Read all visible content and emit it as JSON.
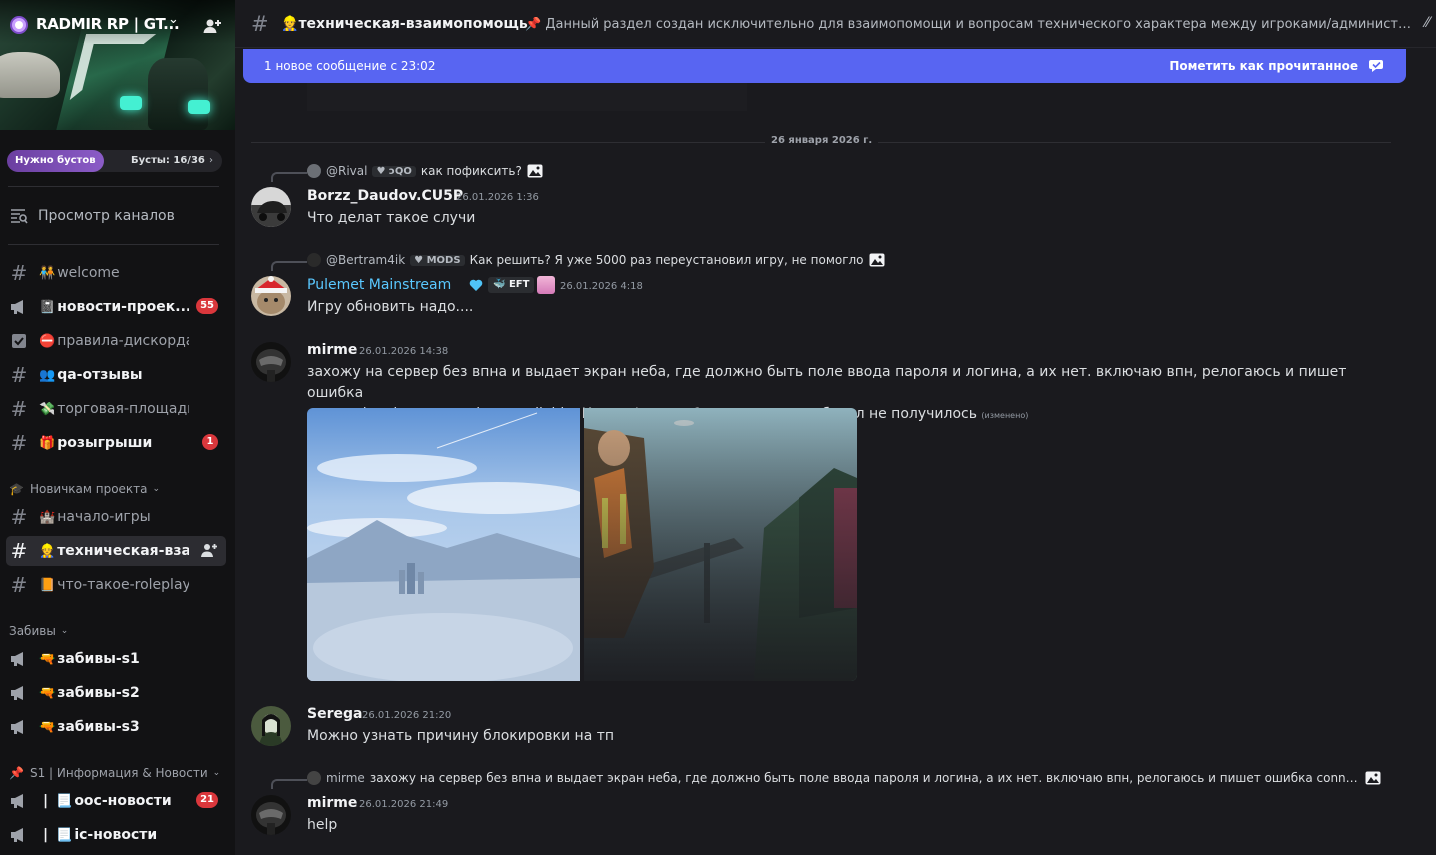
{
  "server": {
    "name": "RADMIR RP | GT...",
    "boost_label": "Нужно бустов",
    "boost_count": "Бусты: 16/36"
  },
  "sidebar": {
    "browse_label": "Просмотр каналов",
    "channels_top": [
      {
        "emoji": "🧑‍🤝‍🧑",
        "label": "welcome",
        "type": "text"
      },
      {
        "emoji": "📓",
        "label": "новости-проек...",
        "type": "announce",
        "badge": "55"
      },
      {
        "emoji": "⛔",
        "label": "правила-дискорда",
        "type": "rules"
      },
      {
        "emoji": "👥",
        "label": "qa-отзывы",
        "type": "text"
      },
      {
        "emoji": "💸",
        "label": "торговая-площадка",
        "type": "text"
      },
      {
        "emoji": "🎁",
        "label": "розыгрыши",
        "type": "text",
        "badge": "1"
      }
    ],
    "category_newbie": "Новичкам проекта",
    "channels_newbie": [
      {
        "emoji": "🏰",
        "label": "начало-игры"
      },
      {
        "emoji": "👷",
        "label": "техническая-вза..."
      },
      {
        "emoji": "📙",
        "label": "что-такое-roleplay"
      }
    ],
    "category_zabivy": "Забивы",
    "channels_zabivy": [
      {
        "emoji": "🔫",
        "label": "забивы-s1"
      },
      {
        "emoji": "🔫",
        "label": "забивы-s2"
      },
      {
        "emoji": "🔫",
        "label": "забивы-s3"
      }
    ],
    "category_s1": "S1 | Информация & Новости",
    "channels_s1": [
      {
        "prefix": "|",
        "emoji": "📃",
        "label": "оос-новости",
        "badge": "21"
      },
      {
        "prefix": "|",
        "emoji": "📃",
        "label": "ic-новости"
      }
    ]
  },
  "header": {
    "channel_emoji": "👷",
    "channel_name": "техническая-взаимопомощь",
    "topic": "📌 Данный раздел создан исключительно для взаимопомощи и вопросам технического характера между игроками/администрацией. ⚠️ Д..."
  },
  "new_messages": {
    "text": "1 новое сообщение с 23:02",
    "mark_read": "Пометить как прочитанное"
  },
  "date_divider": "26 января 2026 г.",
  "messages": [
    {
      "reply": {
        "name": "@Rival",
        "tag": "ɔQO",
        "text": "как пофиксить?"
      },
      "author": "Borzz_Daudov.CU5P",
      "timestamp": "26.01.2026 1:36",
      "text": "Что делат такое случи"
    },
    {
      "reply": {
        "name": "@Bertram4ik",
        "tag": "MODS",
        "text": "Как решить? Я уже 5000 раз переустановил игру, не помогло"
      },
      "author": "Pulemet Mainstream",
      "badge": "EFT",
      "timestamp": "26.01.2026 4:18",
      "text": "Игру обновить надо...."
    },
    {
      "author": "mirme",
      "timestamp": "26.01.2026 14:38",
      "text_line1": "захожу на сервер без впна и выдает экран неба, где должно быть поле ввода пароля и логина, а их нет. включаю впн, релогаюсь и пишет ошибка",
      "text_line2": "connectiom lost. server is unavailable. Как пофиксить? вчера тоже пробовал не получилось",
      "edited": "(изменено)"
    },
    {
      "author": "Serega",
      "timestamp": "26.01.2026 21:20",
      "text": "Можно узнать причину блокировки на тп"
    },
    {
      "reply": {
        "name": "mirme",
        "text": "захожу на сервер без впна и выдает экран неба, где должно быть поле ввода пароля и логина, а их нет. включаю впн, релогаюсь и пишет ошибка connectiom ..."
      },
      "author": "mirme",
      "timestamp": "26.01.2026 21:49",
      "text": "help"
    }
  ],
  "colors": {
    "accent": "#5865f2",
    "badge": "#da373c",
    "sidebar_bg": "#121214",
    "main_bg": "#1a1a1e",
    "username_blue": "#5ac8ff"
  }
}
